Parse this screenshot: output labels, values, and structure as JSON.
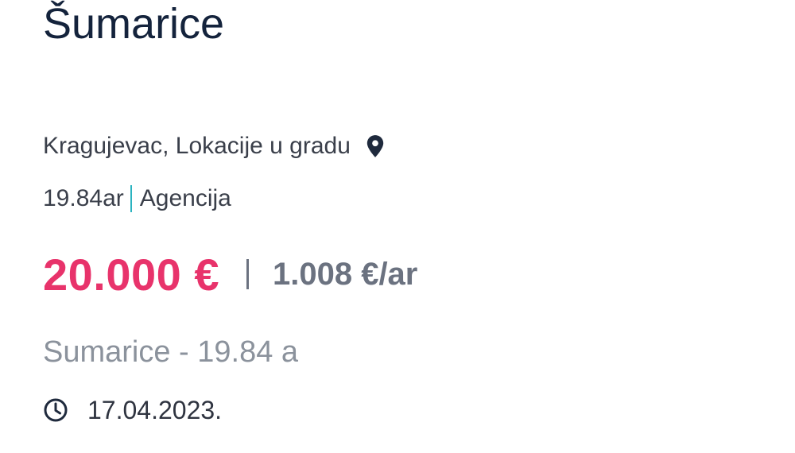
{
  "listing": {
    "title": "Šumarice",
    "location": "Kragujevac, Lokacije u gradu",
    "location_icon": "map-pin-icon",
    "area": "19.84ar",
    "seller_type": "Agencija",
    "price": "20.000 €",
    "price_per_unit": "1.008 €/ar",
    "subtitle": "Sumarice - 19.84 a",
    "date_icon": "clock-icon",
    "date": "17.04.2023."
  },
  "colors": {
    "title": "#14233c",
    "price": "#e8336b",
    "price_per_unit": "#6b7280",
    "meta_divider": "#2bb3c0",
    "subtitle": "#8b929c"
  }
}
